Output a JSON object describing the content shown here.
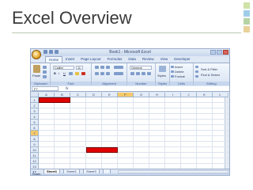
{
  "slide": {
    "title": "Excel Overview"
  },
  "excel": {
    "window_title": "Book1 - Microsoft Excel",
    "tabs": [
      "Home",
      "Insert",
      "Page Layout",
      "Formulas",
      "Data",
      "Review",
      "View",
      "Developer"
    ],
    "active_tab": "Home",
    "ribbon": {
      "clipboard": {
        "label": "Clipboard",
        "paste": "Paste"
      },
      "font": {
        "label": "Font",
        "name": "Calibri",
        "size": "11",
        "bold": "B",
        "italic": "I",
        "underline": "U"
      },
      "alignment": {
        "label": "Alignment"
      },
      "number": {
        "label": "Number",
        "format": "General"
      },
      "styles": {
        "label": "Styles",
        "button": "Styles"
      },
      "cells": {
        "label": "Cells",
        "insert": "Insert",
        "delete": "Delete",
        "format": "Format"
      },
      "editing": {
        "label": "Editing",
        "sort_filter": "Sort & Filter",
        "find_select": "Find & Select"
      }
    },
    "formula_bar": {
      "name_box": "F7",
      "fx": "fx",
      "value": ""
    },
    "columns": [
      "A",
      "B",
      "C",
      "D",
      "E",
      "F",
      "G",
      "H",
      "I",
      "J",
      "K",
      "L"
    ],
    "selected_column": "F",
    "rows": [
      "1",
      "2",
      "3",
      "4",
      "5",
      "6",
      "7",
      "8",
      "9",
      "10",
      "11",
      "12",
      "13"
    ],
    "selected_row": "7",
    "red_cells": [
      {
        "row": "1",
        "col": "A",
        "span": 2,
        "color": "#e00000"
      },
      {
        "row": "10",
        "col": "D",
        "span": 2,
        "color": "#e00000"
      }
    ],
    "sheets": [
      "Sheet1",
      "Sheet2",
      "Sheet3"
    ],
    "active_sheet": "Sheet1",
    "status": "Ready"
  },
  "colors": {
    "accent": "#254a88",
    "ribbon": "#dfe8f5",
    "title_text": "#3a3a3a",
    "red_cell": "#e00000",
    "selected_header": "#f6c96a",
    "deco_squares": [
      "#9fcde8",
      "#cfe2a8",
      "#b6d3a4",
      "#e9d29a"
    ]
  }
}
